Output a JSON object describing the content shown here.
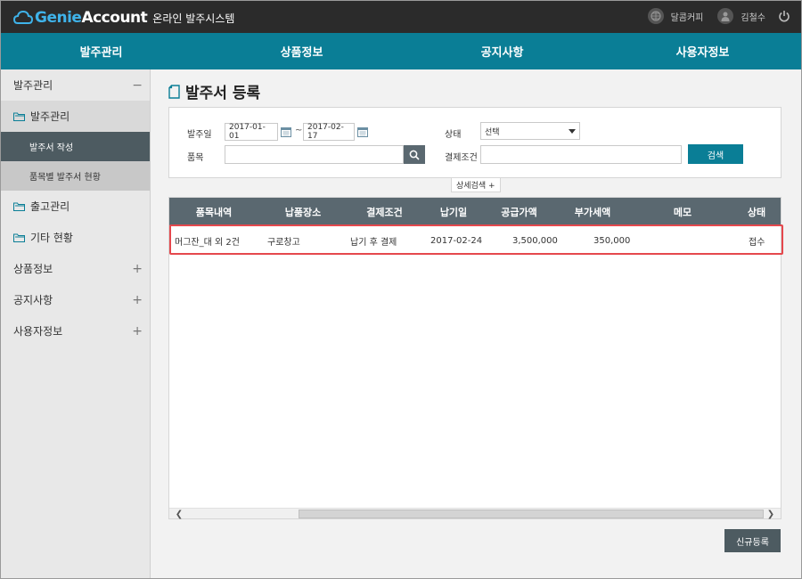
{
  "app": {
    "logo_main": "Genie",
    "logo_accent": "Account",
    "subtitle": "온라인 발주시스템",
    "company": "달콤커피",
    "user": "김철수"
  },
  "nav": [
    "발주관리",
    "상품정보",
    "공지사항",
    "사용자정보"
  ],
  "sidebar": {
    "top": {
      "label": "발주관리",
      "sign": "−"
    },
    "group1": {
      "label": "발주관리"
    },
    "leaf_active": "발주서 작성",
    "leaf_normal": "품목별 발주서 현황",
    "group2": {
      "label": "출고관리"
    },
    "group3": {
      "label": "기타 현황"
    },
    "sections": [
      {
        "label": "상품정보",
        "sign": "+"
      },
      {
        "label": "공지사항",
        "sign": "+"
      },
      {
        "label": "사용자정보",
        "sign": "+"
      }
    ]
  },
  "page": {
    "title": "발주서 등록"
  },
  "search": {
    "order_date_label": "발주일",
    "date_from": "2017-01-01",
    "date_sep": "~",
    "date_to": "2017-02-17",
    "status_label": "상태",
    "status_value": "선택",
    "item_label": "품목",
    "item_value": "",
    "payment_label": "결제조건",
    "payment_value": "",
    "search_button": "검색",
    "detail_toggle": "상세검색 +"
  },
  "table": {
    "headers": [
      "품목내역",
      "납품장소",
      "결제조건",
      "납기일",
      "공급가액",
      "부가세액",
      "메모",
      "상태"
    ],
    "rows": [
      [
        "머그잔_대 외 2건",
        "구로창고",
        "납기 후 결제",
        "2017-02-24",
        "3,500,000",
        "350,000",
        "",
        "접수"
      ]
    ]
  },
  "footer": {
    "new_button": "신규등록"
  },
  "colors": {
    "topbar": "#2b2b2b",
    "nav": "#0a7e96",
    "accent_blue": "#3fb3ea",
    "grid_header": "#5a6870",
    "highlight": "#e5484d"
  }
}
